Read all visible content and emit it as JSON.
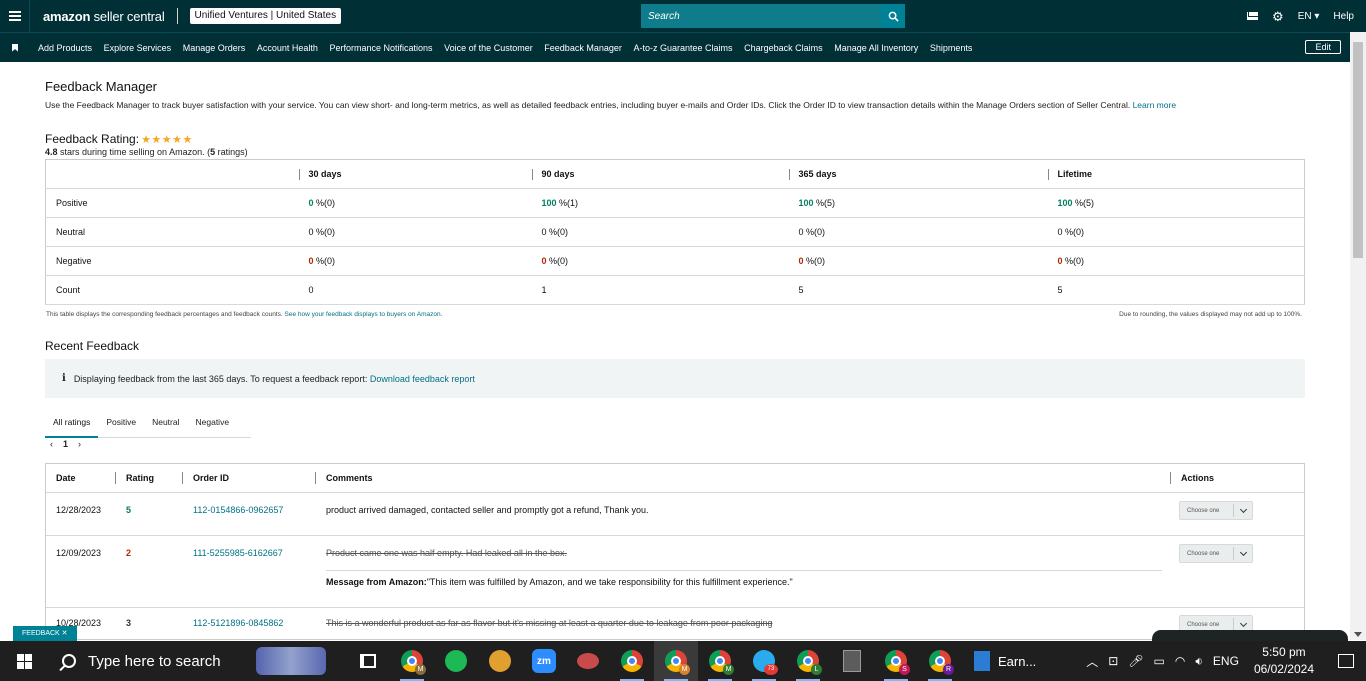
{
  "header": {
    "brand_prefix": "amazon",
    "brand_suffix": " seller central",
    "account": "Unified Ventures | United States",
    "search_placeholder": "Search",
    "language": "EN",
    "help": "Help"
  },
  "nav": {
    "items": [
      "Add Products",
      "Explore Services",
      "Manage Orders",
      "Account Health",
      "Performance Notifications",
      "Voice of the Customer",
      "Feedback Manager",
      "A-to-z Guarantee Claims",
      "Chargeback Claims",
      "Manage All Inventory",
      "Shipments"
    ],
    "edit": "Edit"
  },
  "page": {
    "title": "Feedback Manager",
    "intro": "Use the Feedback Manager to track buyer satisfaction with your service. You can view short- and long-term metrics, as well as detailed feedback entries, including buyer e-mails and Order IDs. Click the Order ID to view transaction details within the Manage Orders section of Seller Central.",
    "learn_more": "Learn more",
    "rating_title": "Feedback Rating:",
    "stars": "★★★★★",
    "rating_value": "4.8",
    "rating_text": " stars during time selling on Amazon. (",
    "rating_count": "5",
    "rating_suffix": " ratings)"
  },
  "metrics": {
    "columns": [
      "30 days",
      "90 days",
      "365 days",
      "Lifetime"
    ],
    "positive_label": "Positive",
    "neutral_label": "Neutral",
    "negative_label": "Negative",
    "count_label": "Count",
    "positive": [
      [
        "0",
        "%(0)"
      ],
      [
        "100",
        "%(1)"
      ],
      [
        "100",
        "%(5)"
      ],
      [
        "100",
        "%(5)"
      ]
    ],
    "neutral": [
      "0 %(0)",
      "0 %(0)",
      "0 %(0)",
      "0 %(0)"
    ],
    "negative": [
      [
        "0",
        "%(0)"
      ],
      [
        "0",
        "%(0)"
      ],
      [
        "0",
        "%(0)"
      ],
      [
        "0",
        "%(0)"
      ]
    ],
    "count": [
      "0",
      "1",
      "5",
      "5"
    ],
    "footnote_left": "This table displays the corresponding feedback percentages and feedback counts.",
    "footnote_link": "See how your feedback displays to buyers on Amazon.",
    "footnote_right": "Due to rounding, the values displayed may not add up to 100%."
  },
  "recent": {
    "title": "Recent Feedback",
    "info_text": "Displaying feedback from the last 365 days. To request a feedback report:",
    "info_link": "Download feedback report",
    "tabs": [
      "All ratings",
      "Positive",
      "Neutral",
      "Negative"
    ],
    "page": "1",
    "headers": {
      "date": "Date",
      "rating": "Rating",
      "order": "Order ID",
      "comments": "Comments",
      "actions": "Actions"
    },
    "rows": [
      {
        "date": "12/28/2023",
        "rating": "5",
        "order": "112-0154866-0962657",
        "comment": "product arrived damaged, contacted seller and promptly got a refund, Thank you.",
        "action": "Choose one"
      },
      {
        "date": "12/09/2023",
        "rating": "2",
        "order": "111-5255985-6162667",
        "comment": "Product came one was half empty. Had leaked all in the box.",
        "msg_label": "Message from Amazon:",
        "msg": " \"This item was fulfilled by Amazon, and we take responsibility for this fulfillment experience.\"",
        "action": "Choose one"
      },
      {
        "date": "10/28/2023",
        "rating": "3",
        "order": "112-5121896-0845862",
        "comment": "This is a wonderful product as far as flavor but it's missing at least a quarter due to leakage from poor packaging",
        "action": "Choose one"
      }
    ]
  },
  "feedback_tag": "FEEDBACK ✕",
  "taskbar": {
    "search": "Type here to search",
    "earn": "Earn...",
    "lang": "ENG",
    "time": "5:50 pm",
    "date": "06/02/2024",
    "telegram_badge": "73"
  },
  "colors": {
    "header_bg": "#002f36",
    "accent": "#008296",
    "link": "#007185",
    "positive": "#067d62",
    "negative": "#b12704",
    "star": "#f5a623"
  }
}
